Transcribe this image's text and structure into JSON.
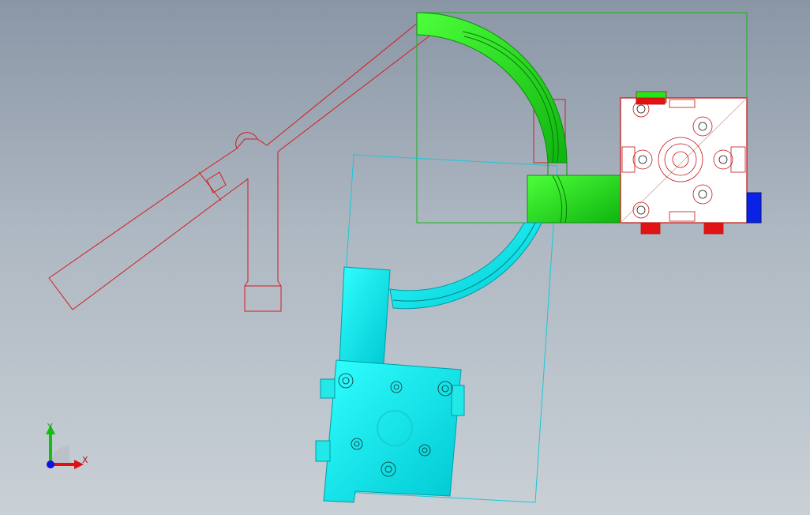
{
  "scene": {
    "background_top": "#8a96a6",
    "background_bottom": "#c9d0d6",
    "colors": {
      "arm_outline": "#d41c1c",
      "green_part": "#22e61a",
      "green_part_dark": "#0aa10a",
      "cyan_part": "#00f0f0",
      "cyan_part_dark": "#009fa8",
      "block_fill": "#ffffff",
      "block_outline": "#c21212",
      "blue_tab": "#0a22e6",
      "bbox_green": "#19b419",
      "bbox_cyan": "#18c8d8"
    }
  },
  "triad": {
    "x_label": "X",
    "y_label": "Y",
    "x_color": "#e01010",
    "y_color": "#10c010",
    "z_color": "#1010e0"
  }
}
